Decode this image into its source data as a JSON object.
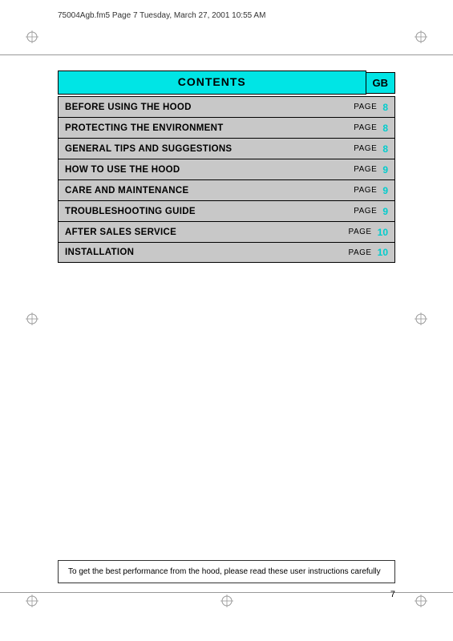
{
  "header": {
    "file_info": "75004Agb.fm5  Page 7  Tuesday, March 27, 2001  10:55 AM"
  },
  "contents": {
    "title": "CONTENTS",
    "gb_label": "GB",
    "rows": [
      {
        "label": "BEFORE USING THE HOOD",
        "page_word": "PAGE",
        "page_num": "8"
      },
      {
        "label": "PROTECTING THE ENVIRONMENT",
        "page_word": "PAGE",
        "page_num": "8"
      },
      {
        "label": "GENERAL TIPS AND SUGGESTIONS",
        "page_word": "PAGE",
        "page_num": "8"
      },
      {
        "label": "HOW TO USE THE HOOD",
        "page_word": "PAGE",
        "page_num": "9"
      },
      {
        "label": "CARE AND MAINTENANCE",
        "page_word": "PAGE",
        "page_num": "9"
      },
      {
        "label": "TROUBLESHOOTING GUIDE",
        "page_word": "PAGE",
        "page_num": "9"
      },
      {
        "label": "AFTER SALES SERVICE",
        "page_word": "PAGE",
        "page_num": "10"
      },
      {
        "label": "INSTALLATION",
        "page_word": "PAGE",
        "page_num": "10"
      }
    ]
  },
  "bottom_note": "To get the best performance from the hood, please read these user instructions carefully",
  "page_number": "7"
}
